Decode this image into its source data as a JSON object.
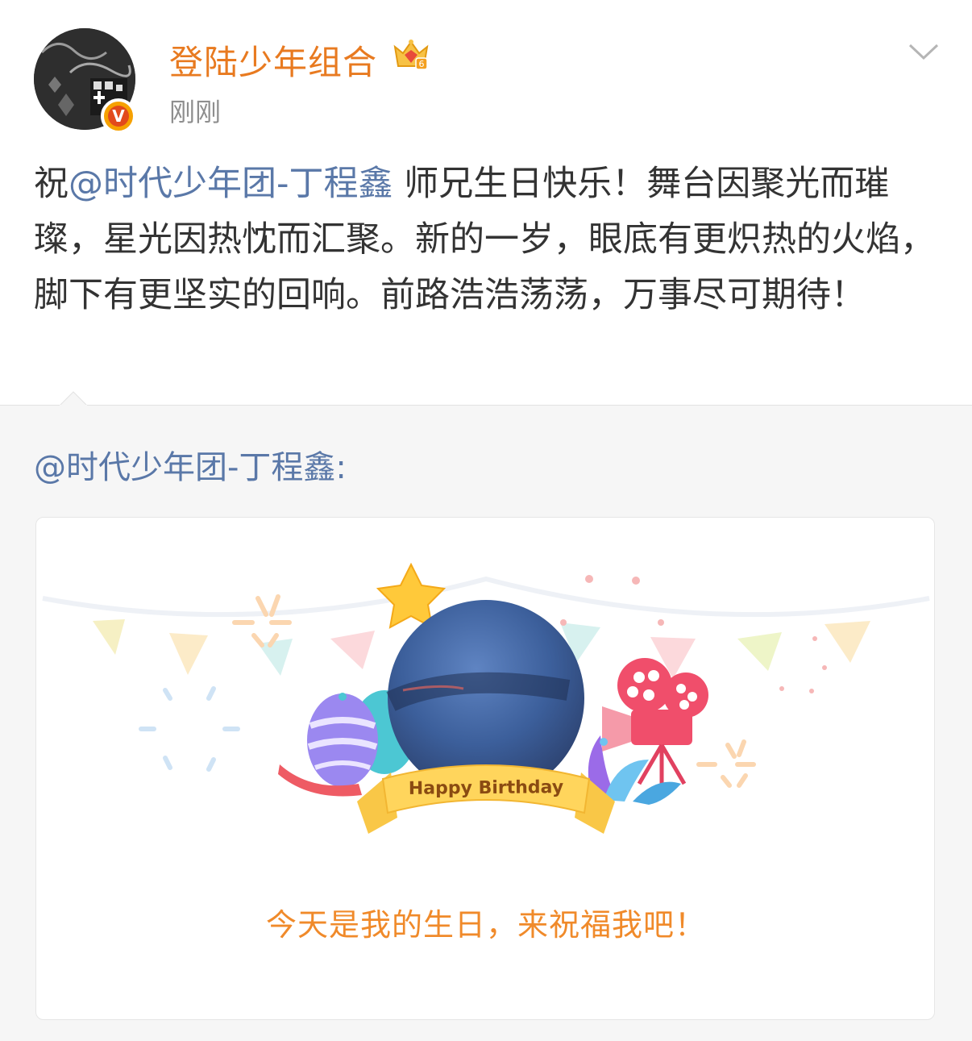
{
  "post": {
    "username": "登陆少年组合",
    "timestamp": "刚刚",
    "body_prefix": "祝",
    "mention": "@时代少年团-丁程鑫",
    "body_text": " 师兄生日快乐！舞台因聚光而璀璨，星光因热忱而汇聚。新的一岁，眼底有更炽热的火焰，脚下有更坚实的回响。前路浩浩荡荡，万事尽可期待！"
  },
  "repost": {
    "author": "@时代少年团-丁程鑫:",
    "card": {
      "banner_text": "Happy Birthday",
      "caption": "今天是我的生日，来祝福我吧！"
    }
  },
  "icons": {
    "crown": "crown-badge-icon",
    "verified": "verified-v-icon",
    "menu": "chevron-down-icon",
    "camera": "film-camera-icon",
    "star": "star-icon"
  },
  "colors": {
    "username": "#e87a20",
    "mention": "#5a78a8",
    "caption": "#f08a2a",
    "repost_bg": "#f6f6f6"
  }
}
